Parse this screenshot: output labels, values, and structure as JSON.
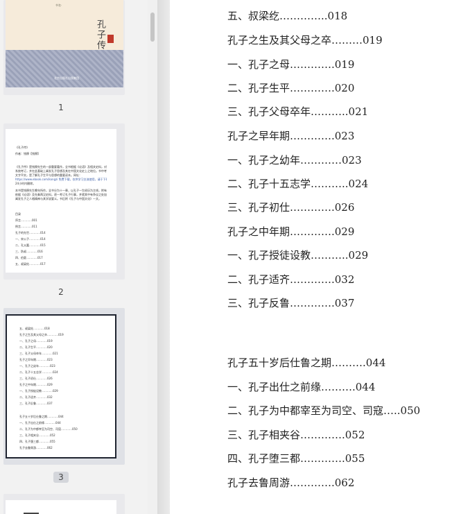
{
  "thumbnails": [
    {
      "page_label": "1",
      "cover": {
        "series": "书名·",
        "title": "孔子传",
        "publisher": "北京出版社出版集团"
      }
    },
    {
      "page_label": "2",
      "lines": [
        "《孔子传》",
        "作者：钱穆【钱穆】",
        "《孔子传》是钱穆先生的一部重要著作，全书根据《论语》及相关史料，对孔子生平事迹作了",
        "系统考订，并在此基础上阐发孔子思想及其在中国文化史上之地位。书中考证详实，论述精当，",
        "文字平实，是了解孔子生平与思想的重要读本。网址：",
        "https://www.ebook.com/kongzi 免费下载，仅供学习交流使用，请于下载后",
        "24小时内删除。",
        "本书是钱穆先生晚年所作，全书分为十一章，以孔子一生经历为主线，附有孔子年表，",
        "依据《论语》及先秦两汉史料，逐一考订孔子行事，并就其中有争议之处加以辨析，",
        "阐发孔子之人格精神与其学说要义。书后附《孔子与中国文化》一文。",
        "目录",
        "序言…………001",
        "例言…………011",
        "孔子的先世…………014",
        "一、宋公子…………014",
        "二、孔父嘉…………015",
        "三、防叔…………016",
        "四、伯夏…………017",
        "五、叔梁纥…………017"
      ]
    },
    {
      "page_label": "3",
      "lines": [
        "五、叔梁纥…………018",
        "孔子之生及其父母之卒…………019",
        "一、孔子之母…………019",
        "二、孔子生平…………020",
        "三、孔子父母卒年…………021",
        "孔子之早年期…………023",
        "一、孔子之幼年…………023",
        "二、孔子十五志学…………024",
        "三、孔子初仕…………026",
        "孔子之中年期…………029",
        "一、孔子授徒设教…………029",
        "二、孔子适齐…………032",
        "三、孔子反鲁…………037",
        "孔子五十岁后仕鲁之期…………044",
        "一、孔子出仕之前缘…………044",
        "二、孔子为中都宰至为司空、司寇…………050",
        "三、孔子相夹谷…………052",
        "四、孔子堕三都…………055",
        "孔子去鲁周游…………062"
      ]
    }
  ],
  "document": {
    "toc": [
      "五、叔梁纥…………..018",
      "孔子之生及其父母之卒………019",
      "一、孔子之母………….019",
      "二、孔子生平………….020",
      "三、孔子父母卒年………..021",
      "孔子之早年期………….023",
      "一、孔子之幼年…………023",
      "二、孔子十五志学………..024",
      "三、孔子初仕………….026",
      "孔子之中年期………….029",
      "一、孔子授徒设教………..029",
      "二、孔子适齐………….032",
      "三、孔子反鲁………….037",
      "孔子五十岁后仕鲁之期……….044",
      "一、孔子出仕之前缘……….044",
      "二、孔子为中都宰至为司空、司寇…..050",
      "三、孔子相夹谷………….052",
      "四、孔子堕三都………….055",
      "孔子去鲁周游………….062"
    ]
  }
}
